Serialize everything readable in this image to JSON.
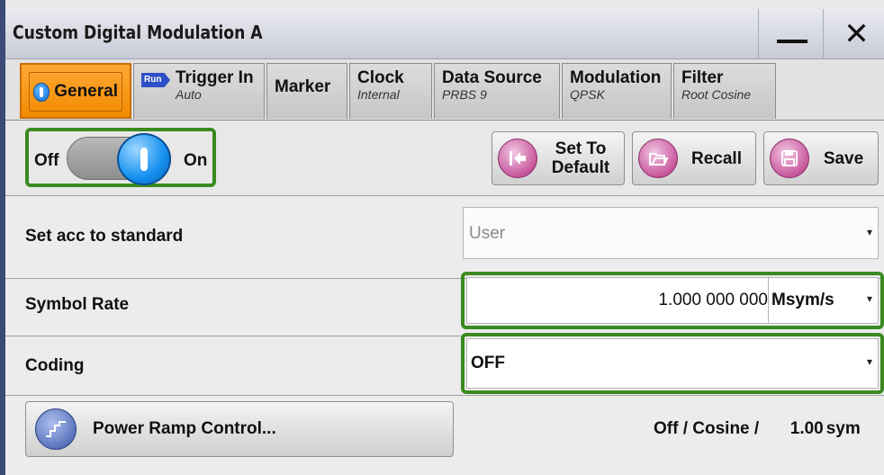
{
  "window": {
    "title": "Custom Digital Modulation A",
    "minimize_icon": "minimize-icon",
    "close_symbol": "✕"
  },
  "tabs": [
    {
      "label": "General",
      "sub": "",
      "active": true,
      "icon": "info-icon"
    },
    {
      "label": "Trigger In",
      "sub": "Auto",
      "icon": "run-icon",
      "icon_text": "Run"
    },
    {
      "label": "Marker",
      "sub": ""
    },
    {
      "label": "Clock",
      "sub": "Internal"
    },
    {
      "label": "Data Source",
      "sub": "PRBS 9"
    },
    {
      "label": "Modulation",
      "sub": "QPSK"
    },
    {
      "label": "Filter",
      "sub": "Root Cosine"
    }
  ],
  "toolbar": {
    "toggle_off_label": "Off",
    "toggle_on_label": "On",
    "state": "On",
    "set_default_label_1": "Set To",
    "set_default_label_2": "Default",
    "recall_label": "Recall",
    "save_label": "Save"
  },
  "form": {
    "standard_label": "Set acc to standard",
    "standard_value": "User",
    "symbol_rate_label": "Symbol Rate",
    "symbol_rate_value": "1.000 000 000",
    "symbol_rate_unit": "Msym/s",
    "coding_label": "Coding",
    "coding_value": "OFF"
  },
  "power_ramp": {
    "button_label": "Power Ramp Control...",
    "status_text": "Off / Cosine /",
    "status_value": "1.00",
    "status_unit": "sym"
  },
  "colors": {
    "accent_tab": "#f28a00",
    "highlight": "#3a8a1f",
    "knob": "#1590f0"
  }
}
